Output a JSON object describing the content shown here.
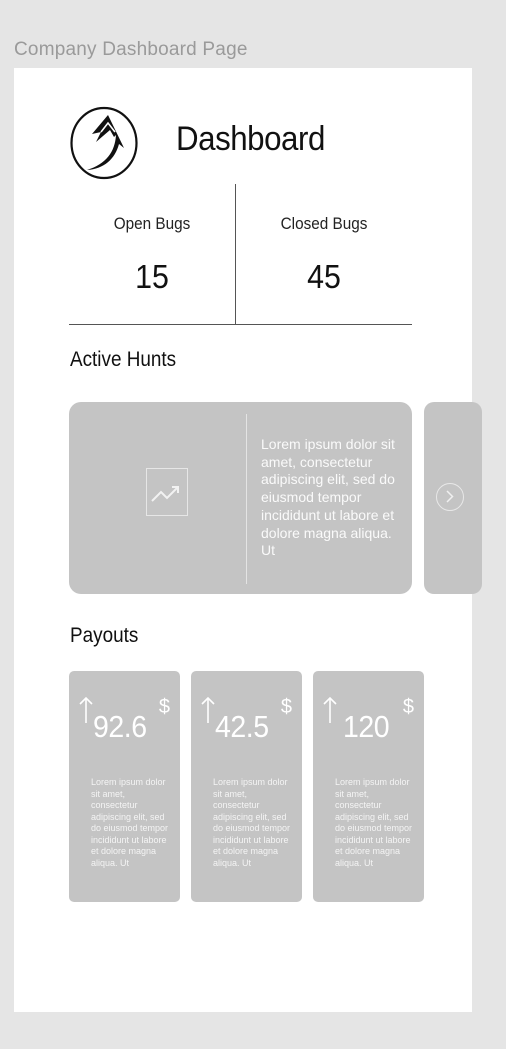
{
  "frame_label": "Company Dashboard Page",
  "header": {
    "title": "Dashboard",
    "logo_icon": "arrow-up-logo-icon"
  },
  "stats": {
    "open_label": "Open Bugs",
    "open_value": "15",
    "closed_label": "Closed Bugs",
    "closed_value": "45"
  },
  "active_hunts": {
    "title": "Active Hunts",
    "card_text": "Lorem ipsum dolor sit amet, consectetur adipiscing elit, sed do eiusmod tempor incididunt ut labore et dolore magna aliqua. Ut",
    "card_icon": "trending-up-icon",
    "next_icon": "chevron-right-icon"
  },
  "payouts": {
    "title": "Payouts",
    "items": [
      {
        "amount": "92.6",
        "currency": "$",
        "text": "Lorem ipsum dolor sit amet, consectetur adipiscing elit, sed do eiusmod tempor incididunt ut labore et dolore magna aliqua. Ut"
      },
      {
        "amount": "42.5",
        "currency": "$",
        "text": "Lorem ipsum dolor sit amet, consectetur adipiscing elit, sed do eiusmod tempor incididunt ut labore et dolore magna aliqua. Ut"
      },
      {
        "amount": "120",
        "currency": "$",
        "text": "Lorem ipsum dolor sit amet, consectetur adipiscing elit, sed do eiusmod tempor incididunt ut labore et dolore magna aliqua. Ut"
      }
    ]
  },
  "colors": {
    "card": "#c4c4c4",
    "frame": "#ffffff",
    "canvas": "#e5e5e5"
  }
}
